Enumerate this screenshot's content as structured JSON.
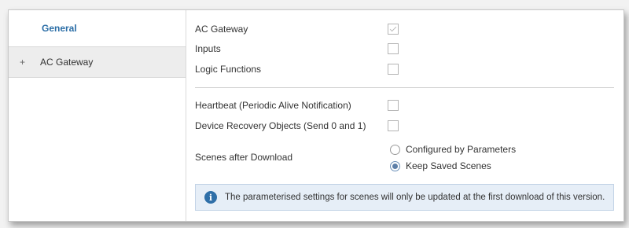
{
  "sidebar": {
    "items": [
      {
        "label": "General",
        "selected": true
      },
      {
        "label": "AC Gateway",
        "expander": "+"
      }
    ]
  },
  "general": {
    "modules": [
      {
        "label": "AC Gateway",
        "checked": true,
        "disabled": true
      },
      {
        "label": "Inputs",
        "checked": false
      },
      {
        "label": "Logic Functions",
        "checked": false
      }
    ],
    "options": [
      {
        "label": "Heartbeat (Periodic Alive Notification)",
        "checked": false
      },
      {
        "label": "Device Recovery Objects (Send 0 and 1)",
        "checked": false
      }
    ],
    "scenes": {
      "label": "Scenes after Download",
      "choices": [
        {
          "label": "Configured by Parameters",
          "selected": false
        },
        {
          "label": "Keep Saved Scenes",
          "selected": true
        }
      ]
    },
    "info": {
      "icon": "info-icon",
      "text": "The parameterised settings for scenes will only be updated at the first download of this version."
    }
  },
  "colors": {
    "accent": "#2a6da6",
    "info_bg": "#e6eef7",
    "info_icon": "#2f6fa8"
  }
}
